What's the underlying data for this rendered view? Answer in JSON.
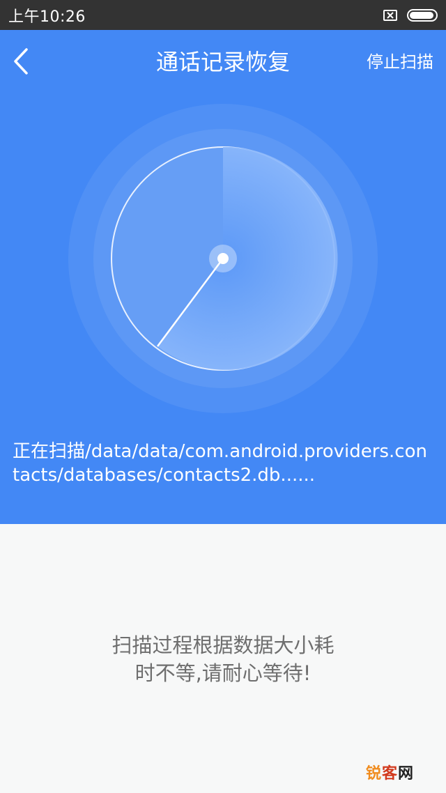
{
  "status_bar": {
    "time": "上午10:26",
    "icons": [
      "sim-off-icon",
      "battery-icon"
    ],
    "battery_level": 0.95
  },
  "nav": {
    "back_icon": "chevron-left-icon",
    "title": "通话记录恢复",
    "stop_label": "停止扫描"
  },
  "scanner": {
    "path_text": "正在扫描/data/data/com.android.providers.contacts/databases/contacts2.db......"
  },
  "hint": {
    "line1": "扫描过程根据数据大小耗",
    "line2": "时不等,请耐心等待!"
  },
  "watermark": {
    "part1": "锐",
    "part2": "客",
    "part3": "网"
  },
  "colors": {
    "status_bar_bg": "#333333",
    "primary_blue": "#4388f5",
    "page_bg": "#f7f8f8",
    "hint_text": "#6e6e6e"
  }
}
